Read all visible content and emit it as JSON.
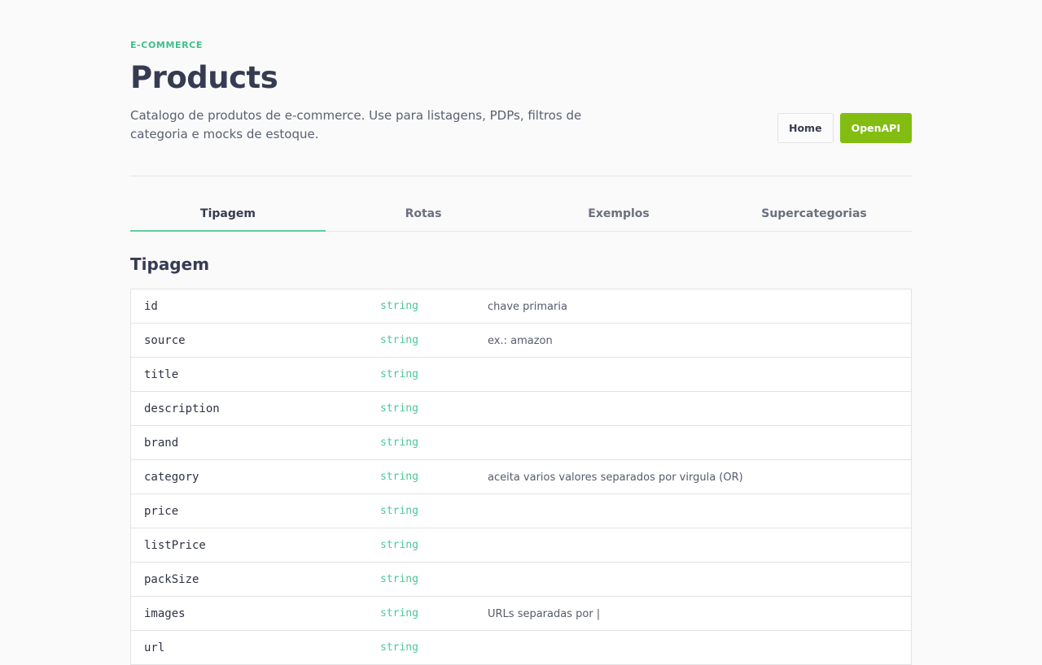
{
  "header": {
    "eyebrow": "E-COMMERCE",
    "title": "Products",
    "description": "Catalogo de produtos de e-commerce. Use para listagens, PDPs, filtros de categoria e mocks de estoque.",
    "buttons": {
      "home": "Home",
      "openapi": "OpenAPI"
    }
  },
  "tabs": [
    {
      "label": "Tipagem",
      "active": true
    },
    {
      "label": "Rotas",
      "active": false
    },
    {
      "label": "Exemplos",
      "active": false
    },
    {
      "label": "Supercategorias",
      "active": false
    }
  ],
  "section": {
    "title": "Tipagem"
  },
  "fields": [
    {
      "name": "id",
      "type": "string",
      "note": "chave primaria"
    },
    {
      "name": "source",
      "type": "string",
      "note": "ex.: amazon"
    },
    {
      "name": "title",
      "type": "string",
      "note": ""
    },
    {
      "name": "description",
      "type": "string",
      "note": ""
    },
    {
      "name": "brand",
      "type": "string",
      "note": ""
    },
    {
      "name": "category",
      "type": "string",
      "note": "aceita varios valores separados por virgula (OR)"
    },
    {
      "name": "price",
      "type": "string",
      "note": ""
    },
    {
      "name": "listPrice",
      "type": "string",
      "note": ""
    },
    {
      "name": "packSize",
      "type": "string",
      "note": ""
    },
    {
      "name": "images",
      "type": "string",
      "note": "URLs separadas por |"
    },
    {
      "name": "url",
      "type": "string",
      "note": ""
    }
  ],
  "colors": {
    "accent": "#3fbf8c",
    "button_primary": "#83bd12",
    "type_text": "#4cc797"
  }
}
